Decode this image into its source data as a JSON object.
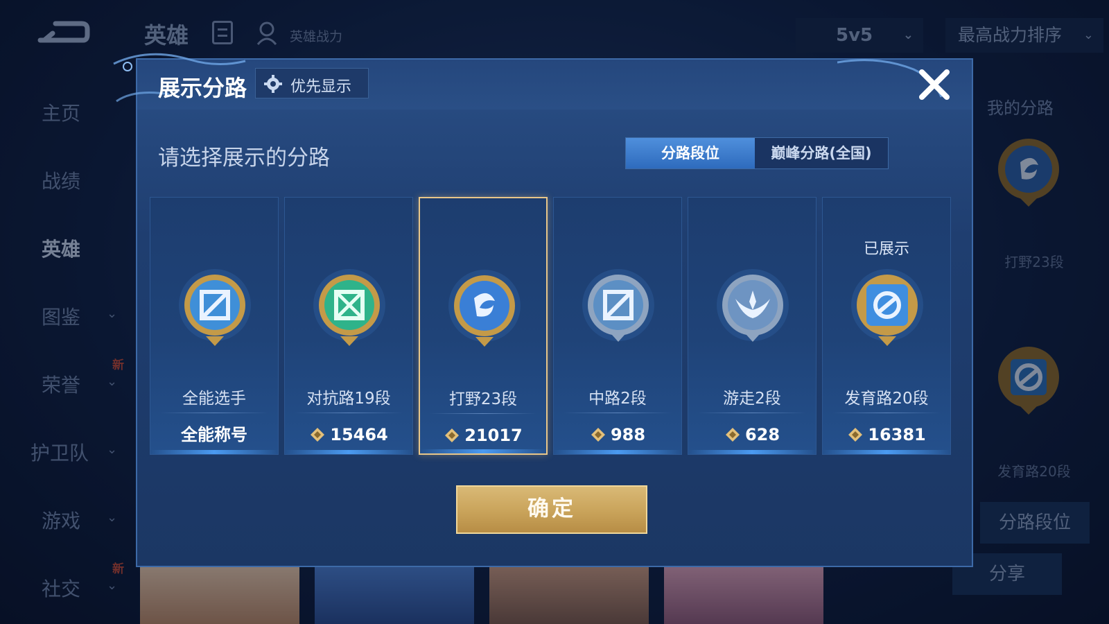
{
  "app": {
    "top_title": "英雄",
    "power_label": "英雄战力",
    "mode_select": "5v5",
    "sort_select": "最高战力排序"
  },
  "side_nav": [
    {
      "label": "主页",
      "has_arrow": false
    },
    {
      "label": "战绩",
      "has_arrow": false
    },
    {
      "label": "英雄",
      "has_arrow": false,
      "active": true
    },
    {
      "label": "图鉴",
      "has_arrow": true
    },
    {
      "label": "荣誉",
      "has_arrow": true,
      "badge": "新"
    },
    {
      "label": "护卫队",
      "has_arrow": true
    },
    {
      "label": "游戏",
      "has_arrow": true
    },
    {
      "label": "社交",
      "has_arrow": true,
      "badge": "新"
    }
  ],
  "right_panel": {
    "title": "我的分路",
    "badge1_label": "打野23段",
    "badge2_label": "发育路20段",
    "lane_rank_button": "分路段位",
    "share_button": "分享"
  },
  "modal": {
    "title": "展示分路",
    "priority_button": "优先显示",
    "subtitle": "请选择展示的分路",
    "tabs": [
      {
        "label": "分路段位",
        "active": true
      },
      {
        "label": "巅峰分路(全国)",
        "active": false
      }
    ],
    "cards": [
      {
        "name": "全能选手",
        "stat": "全能称号",
        "badge_icon": "all-round-badge-icon",
        "badge_color": "#4a9de0"
      },
      {
        "name": "对抗路19段",
        "stat": "15464",
        "badge_icon": "clash-lane-badge-icon",
        "badge_color": "#2fb38a"
      },
      {
        "name": "打野23段",
        "stat": "21017",
        "badge_icon": "jungle-badge-icon",
        "badge_color": "#3a7fd6",
        "selected": true
      },
      {
        "name": "中路2段",
        "stat": "988",
        "badge_icon": "mid-lane-badge-icon",
        "badge_color": "#5c8fc4"
      },
      {
        "name": "游走2段",
        "stat": "628",
        "badge_icon": "roam-badge-icon",
        "badge_color": "#6e94c2"
      },
      {
        "name": "发育路20段",
        "stat": "16381",
        "badge_icon": "farm-lane-badge-icon",
        "badge_color": "#3f8ee0",
        "shown_label": "已展示"
      }
    ],
    "confirm_button": "确定"
  },
  "colors": {
    "accent_gold": "#e8c689",
    "tab_active": "#3f7fcf",
    "modal_bg": "#1f3e70"
  }
}
